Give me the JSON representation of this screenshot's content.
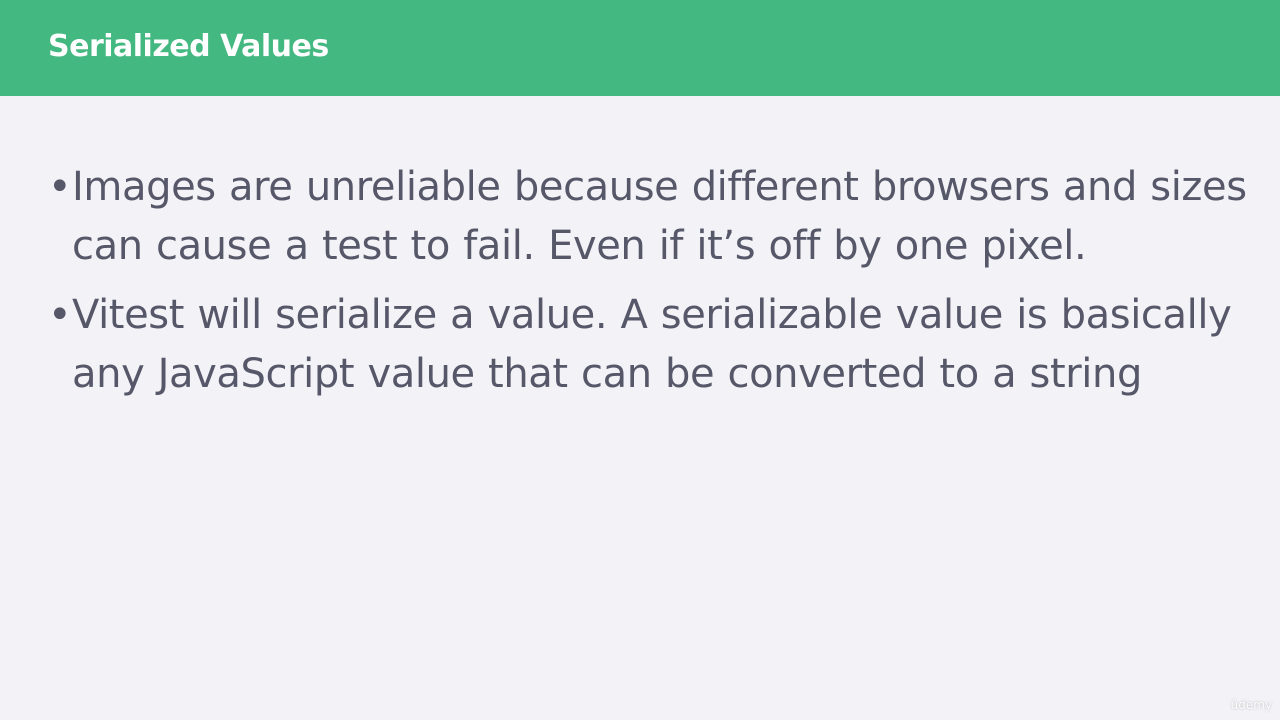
{
  "slide": {
    "title": "Serialized Values",
    "bullets": [
      {
        "marker": "•",
        "text": "Images are unreliable because different browsers and sizes can cause a test to fail. Even if it’s off by one pixel."
      },
      {
        "marker": "•",
        "text": "Vitest will serialize a value. A serializable value is basically any JavaScript value that can be converted to a string"
      }
    ],
    "watermark": "ûdemy"
  },
  "colors": {
    "header_background": "#44b881",
    "slide_background": "#f3f2f6",
    "title_text": "#ffffff",
    "body_text": "#56586a"
  }
}
